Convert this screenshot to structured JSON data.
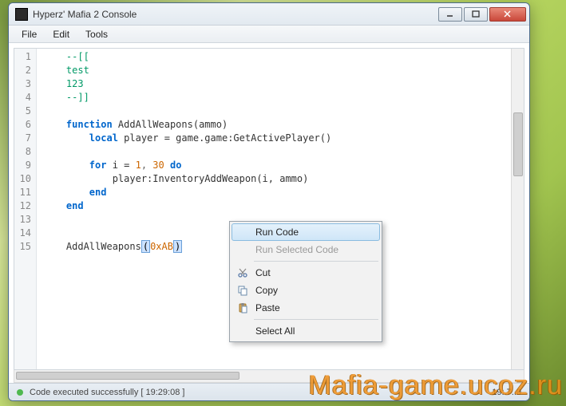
{
  "window": {
    "title": "Hyperz' Mafia 2 Console"
  },
  "menubar": {
    "file": "File",
    "edit": "Edit",
    "tools": "Tools"
  },
  "code": {
    "lines": {
      "l1": "--[[",
      "l2": "test",
      "l3": "123",
      "l4": "--]]",
      "l6_kw": "function",
      "l6_name": " AddAllWeapons",
      "l6_args": "(ammo)",
      "l7_kw": "local",
      "l7_rest": " player = game.game:GetActivePlayer()",
      "l9_for": "for",
      "l9_i": " i = ",
      "l9_a": "1",
      "l9_c": ", ",
      "l9_b": "30",
      "l9_do": " do",
      "l10": "player:InventoryAddWeapon(i, ammo)",
      "l11": "end",
      "l12": "end",
      "l15_call": "AddAllWeapons",
      "l15_open": "(",
      "l15_hex": "0xAB",
      "l15_close": ")"
    }
  },
  "context_menu": {
    "run_code": "Run Code",
    "run_selected": "Run Selected Code",
    "cut": "Cut",
    "copy": "Copy",
    "paste": "Paste",
    "select_all": "Select All"
  },
  "statusbar": {
    "text": "Code executed successfully [ 19:29:08 ]",
    "right": "19:.7..0"
  },
  "watermark": "Mafia-game.ucoz.ru"
}
